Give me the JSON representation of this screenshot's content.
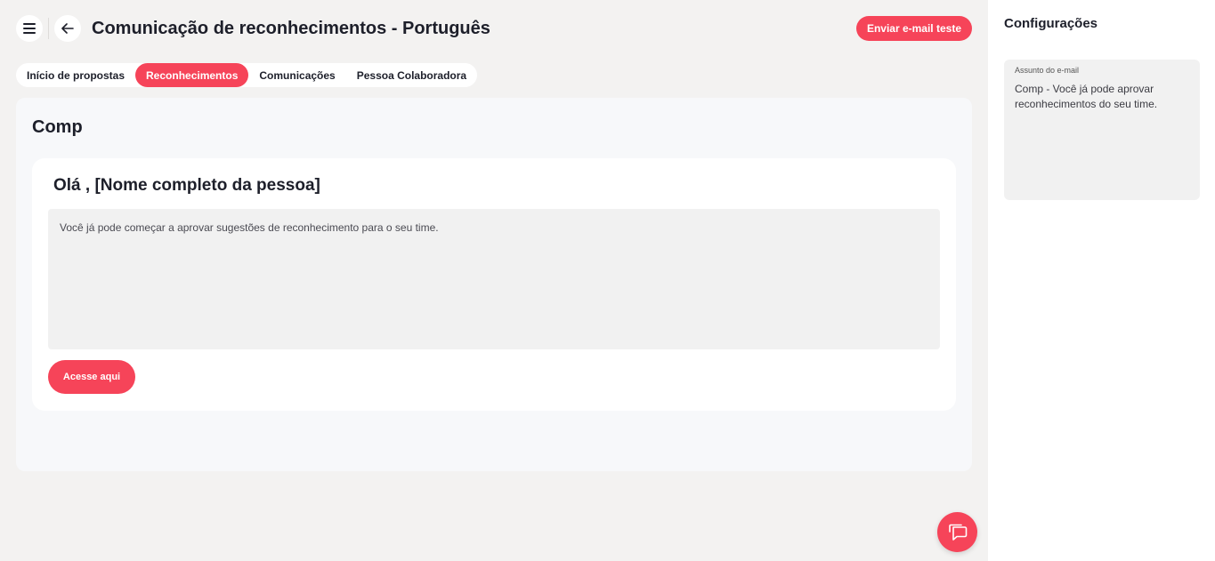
{
  "header": {
    "title": "Comunicação de reconhecimentos - Português",
    "send_test_label": "Enviar e-mail teste",
    "menu_icon": "hamburger-menu-icon",
    "back_icon": "arrow-left-icon"
  },
  "tabs": [
    {
      "label": "Início de propostas",
      "active": false
    },
    {
      "label": "Reconhecimentos",
      "active": true
    },
    {
      "label": "Comunicações",
      "active": false
    },
    {
      "label": "Pessoa Colaboradora",
      "active": false
    }
  ],
  "main": {
    "panel_title": "Comp",
    "greeting": "Olá , [Nome completo da pessoa]",
    "body_text": "Você já pode começar a aprovar sugestões de reconhecimento para o seu time.",
    "cta_label": "Acesse aqui"
  },
  "sidebar": {
    "title": "Configurações",
    "subject_label": "Assunto do e-mail",
    "subject_value": "Comp - Você já pode aprovar reconhecimentos do seu time."
  },
  "chat": {
    "icon": "chat-bubbles-icon"
  },
  "colors": {
    "accent": "#f64459",
    "background": "#f3f2f1",
    "panel": "#f7f8fa"
  }
}
